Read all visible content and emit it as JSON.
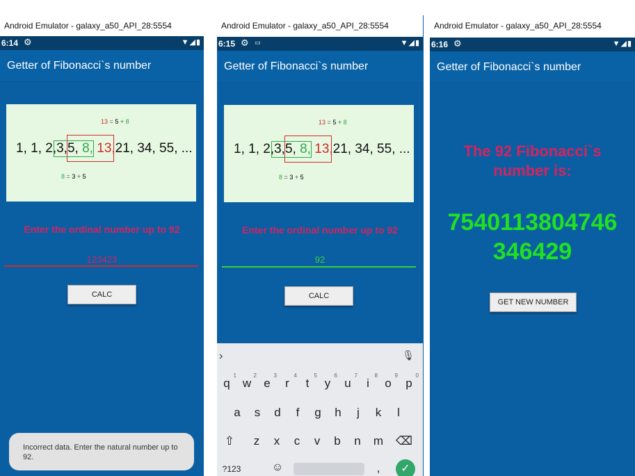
{
  "window_title": "Android Emulator - galaxy_a50_API_28:5554",
  "app_title": "Getter of Fibonacci`s number",
  "fib_image": {
    "top_formula": [
      "13",
      "=",
      "5",
      "+",
      "8"
    ],
    "bottom_formula": [
      "8",
      "=",
      "3",
      "+",
      "5"
    ],
    "sequence": {
      "a": "1, 1, 2,",
      "b": "3,",
      "c": "5,",
      "d": "8,",
      "e": "13,",
      "f": "21, 34, 55, ..."
    }
  },
  "prompt": "Enter the ordinal number  up to 92",
  "screens": [
    {
      "time": "6:14",
      "input_value": "123423",
      "button": "CALC",
      "toast": "Incorrect data. Enter the natural number up to 92."
    },
    {
      "time": "6:15",
      "input_value": "92",
      "button": "CALC",
      "keyboard": {
        "row1": [
          [
            "q",
            "1"
          ],
          [
            "w",
            "2"
          ],
          [
            "e",
            "3"
          ],
          [
            "r",
            "4"
          ],
          [
            "t",
            "5"
          ],
          [
            "y",
            "6"
          ],
          [
            "u",
            "7"
          ],
          [
            "i",
            "8"
          ],
          [
            "o",
            "9"
          ],
          [
            "p",
            "0"
          ]
        ],
        "row2": [
          "a",
          "s",
          "d",
          "f",
          "g",
          "h",
          "j",
          "k",
          "l"
        ],
        "row3": [
          "z",
          "x",
          "c",
          "v",
          "b",
          "n",
          "m"
        ],
        "symbols_key": "?123",
        "comma_key": ","
      }
    },
    {
      "time": "6:16",
      "result_title": "The 92 Fibonacci`s number is:",
      "result_value_line1": "7540113804746",
      "result_value_line2": "346429",
      "button": "GET NEW NUMBER"
    }
  ],
  "colors": {
    "background": "#0a5fa3",
    "statusbar": "#073f6a",
    "prompt": "#d4245e",
    "result_number": "#21e021",
    "input_line_error": "#d42a2a",
    "input_line_ok": "#3ccf3c"
  }
}
